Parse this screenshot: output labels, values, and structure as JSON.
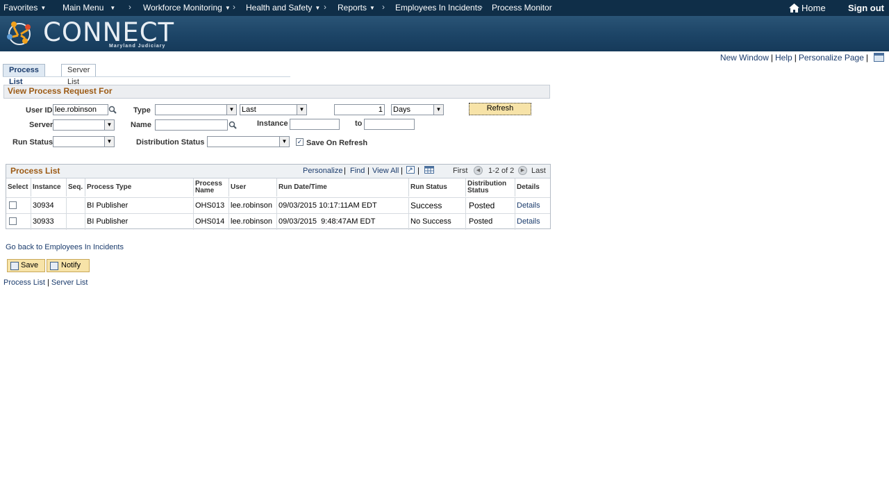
{
  "nav": {
    "items": [
      "Favorites",
      "Main Menu",
      "Workforce Monitoring",
      "Health and Safety",
      "Reports",
      "Employees In Incidents",
      "Process Monitor"
    ],
    "home": "Home",
    "signout": "Sign out"
  },
  "brand": {
    "name": "CONNECT",
    "subtitle": "Maryland Judiciary"
  },
  "toplinks": {
    "new_window": "New Window",
    "help": "Help",
    "personalize": "Personalize Page"
  },
  "tabs": {
    "process_list": "Process List",
    "server_list": "Server List"
  },
  "form": {
    "title": "View Process Request For",
    "user_id_label": "User ID",
    "user_id_value": "lee.robinson",
    "type_label": "Type",
    "type_value": "",
    "last_value": "Last",
    "count_value": "1",
    "unit_value": "Days",
    "refresh": "Refresh",
    "server_label": "Server",
    "name_label": "Name",
    "instance_label": "Instance",
    "to_label": "to",
    "run_status_label": "Run Status",
    "dist_status_label": "Distribution Status",
    "save_on_refresh": "Save On Refresh",
    "save_on_refresh_checked": "✓"
  },
  "grid": {
    "title": "Process List",
    "personalize": "Personalize",
    "find": "Find",
    "view_all": "View All",
    "first": "First",
    "range": "1-2 of 2",
    "last": "Last",
    "headers": {
      "select": "Select",
      "instance": "Instance",
      "seq": "Seq.",
      "process_type": "Process Type",
      "process_name": "Process Name",
      "user": "User",
      "run_datetime": "Run Date/Time",
      "run_status": "Run Status",
      "dist_status": "Distribution Status",
      "details": "Details"
    },
    "rows": [
      {
        "instance": "30934",
        "seq": "",
        "process_type": "BI Publisher",
        "process_name": "OHS013",
        "user": "lee.robinson",
        "run_datetime": "09/03/2015 10:17:11AM EDT",
        "run_status": "Success",
        "dist_status": "Posted",
        "details": "Details"
      },
      {
        "instance": "30933",
        "seq": "",
        "process_type": "BI Publisher",
        "process_name": "OHS014",
        "user": "lee.robinson",
        "run_datetime": "09/03/2015  9:48:47AM EDT",
        "run_status": "No Success",
        "dist_status": "Posted",
        "details": "Details"
      }
    ]
  },
  "footer": {
    "go_back": "Go back to Employees In Incidents",
    "save": "Save",
    "notify": "Notify",
    "process_list": "Process List",
    "server_list": "Server List"
  }
}
